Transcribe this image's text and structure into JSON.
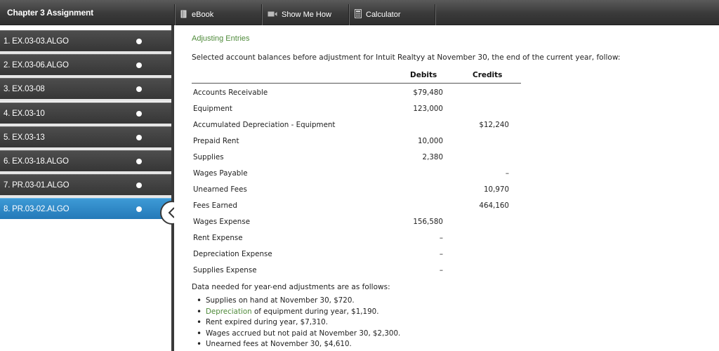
{
  "app": {
    "title": "Chapter 3 Assignment"
  },
  "toolbar": {
    "ebook_label": "eBook",
    "show_me_how_label": "Show Me How",
    "calculator_label": "Calculator"
  },
  "sidebar": {
    "items": [
      {
        "label": "1. EX.03-03.ALGO"
      },
      {
        "label": "2. EX.03-06.ALGO"
      },
      {
        "label": "3. EX.03-08"
      },
      {
        "label": "4. EX.03-10"
      },
      {
        "label": "5. EX.03-13"
      },
      {
        "label": "6. EX.03-18.ALGO"
      },
      {
        "label": "7. PR.03-01.ALGO"
      },
      {
        "label": "8. PR.03-02.ALGO"
      }
    ],
    "active_index": 7
  },
  "main": {
    "heading": "Adjusting Entries",
    "intro": "Selected account balances before adjustment for Intuit Realtyy at November 30, the end of the current year, follow:",
    "col_debits": "Debits",
    "col_credits": "Credits",
    "rows": [
      {
        "account": "Accounts Receivable",
        "debit": "$79,480",
        "credit": ""
      },
      {
        "account": "Equipment",
        "debit": "123,000",
        "credit": ""
      },
      {
        "account": "Accumulated Depreciation - Equipment",
        "debit": "",
        "credit": "$12,240"
      },
      {
        "account": "Prepaid Rent",
        "debit": "10,000",
        "credit": ""
      },
      {
        "account": "Supplies",
        "debit": "2,380",
        "credit": ""
      },
      {
        "account": "Wages Payable",
        "debit": "",
        "credit": "–"
      },
      {
        "account": "Unearned Fees",
        "debit": "",
        "credit": "10,970"
      },
      {
        "account": "Fees Earned",
        "debit": "",
        "credit": "464,160"
      },
      {
        "account": "Wages Expense",
        "debit": "156,580",
        "credit": ""
      },
      {
        "account": "Rent Expense",
        "debit": "–",
        "credit": ""
      },
      {
        "account": "Depreciation Expense",
        "debit": "–",
        "credit": ""
      },
      {
        "account": "Supplies Expense",
        "debit": "–",
        "credit": ""
      }
    ],
    "data_intro": "Data needed for year-end adjustments are as follows:",
    "adjustments": {
      "supplies": "Supplies on hand at November 30, $720.",
      "depreciation_link": "Depreciation",
      "depreciation_rest": " of equipment during year, $1,190.",
      "rent": "Rent expired during year, $7,310.",
      "wages": "Wages accrued but not paid at November 30, $2,300.",
      "unearned": "Unearned fees at November 30, $4,610."
    }
  },
  "icons": {
    "ebook": "book-icon",
    "show_me_how": "video-icon",
    "calculator": "calculator-icon",
    "collapse": "chevron-left-icon"
  }
}
